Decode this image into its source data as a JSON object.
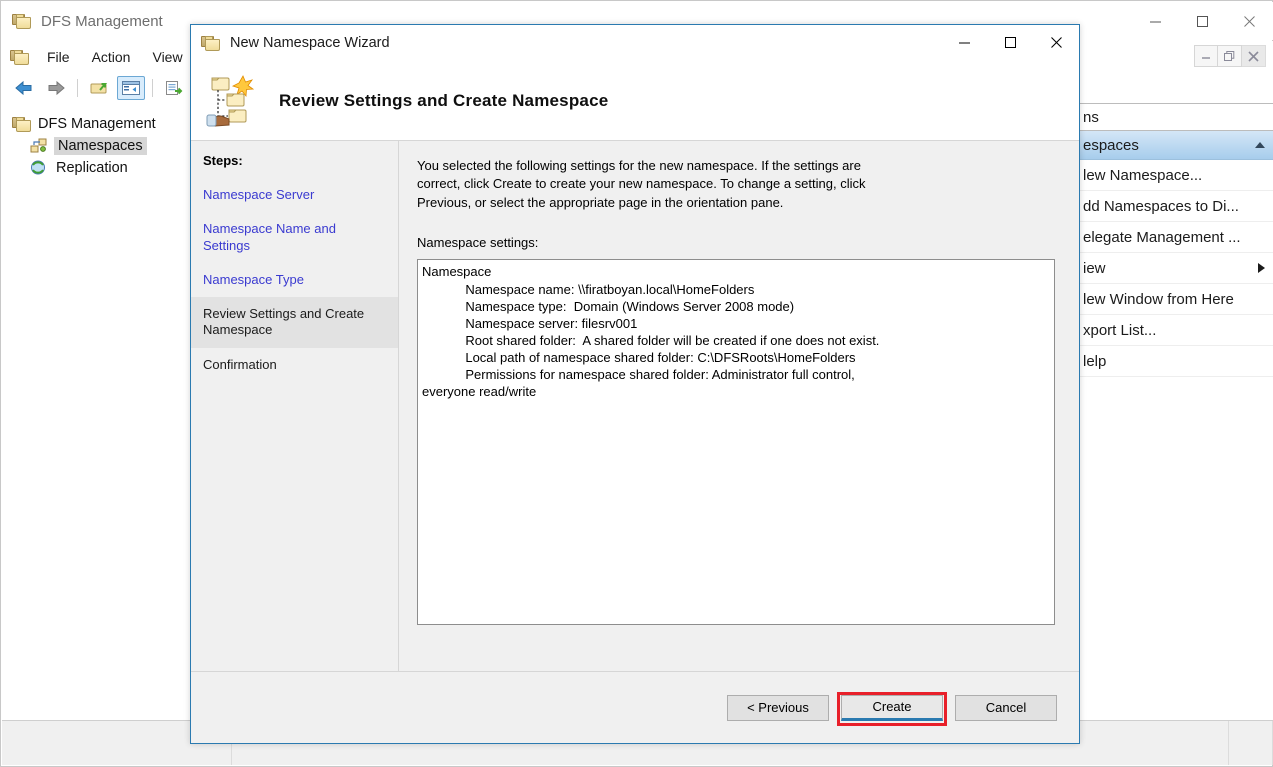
{
  "mmc": {
    "title": "DFS Management",
    "title_icon": "dfs-folder-icon",
    "menu": [
      {
        "label": "File"
      },
      {
        "label": "Action"
      },
      {
        "label": "View"
      }
    ],
    "toolbar": [
      {
        "name": "back-icon",
        "glyph": "←"
      },
      {
        "name": "forward-icon",
        "glyph": "→"
      },
      {
        "name": "up-folder-icon",
        "glyph": "↗"
      },
      {
        "name": "show-hide-console-tree-icon",
        "glyph": "▤"
      },
      {
        "name": "export-list-icon",
        "glyph": "≡"
      }
    ],
    "tree": [
      {
        "label": "DFS Management",
        "icon": "dfs-folder-icon",
        "selected": false,
        "level": 0
      },
      {
        "label": "Namespaces",
        "icon": "namespaces-icon",
        "selected": true,
        "level": 1
      },
      {
        "label": "Replication",
        "icon": "replication-icon",
        "selected": false,
        "level": 1
      }
    ],
    "window_controls": [
      {
        "name": "minimize-button",
        "glyph": "—"
      },
      {
        "name": "maximize-button",
        "glyph": "□"
      },
      {
        "name": "close-button",
        "glyph": "✕"
      }
    ],
    "mdi_controls": [
      {
        "name": "mdi-minimize-button",
        "glyph": "—"
      },
      {
        "name": "mdi-restore-button",
        "glyph": "❐"
      },
      {
        "name": "mdi-close-button",
        "glyph": "✕"
      }
    ]
  },
  "actions_pane": {
    "title": "ns",
    "group_header": "espaces",
    "items": [
      {
        "label": "lew Namespace...",
        "submenu": false
      },
      {
        "label": "dd Namespaces to Di...",
        "submenu": false
      },
      {
        "label": "elegate Management ...",
        "submenu": false
      },
      {
        "label": "iew",
        "submenu": true
      },
      {
        "label": "lew Window from Here",
        "submenu": false
      },
      {
        "label": "xport List...",
        "submenu": false
      },
      {
        "label": "lelp",
        "submenu": false
      }
    ]
  },
  "wizard": {
    "title": "New Namespace Wizard",
    "title_icon": "namespace-wizard-icon",
    "header_title": "Review Settings and Create Namespace",
    "header_icon": "namespace-create-icon",
    "window_controls": [
      {
        "name": "minimize-button",
        "glyph": "—"
      },
      {
        "name": "maximize-button",
        "glyph": "□"
      },
      {
        "name": "close-button",
        "glyph": "✕"
      }
    ],
    "steps_heading": "Steps:",
    "steps": [
      {
        "label": "Namespace Server",
        "state": "link"
      },
      {
        "label": "Namespace Name and Settings",
        "state": "link"
      },
      {
        "label": "Namespace Type",
        "state": "link"
      },
      {
        "label": "Review Settings and Create Namespace",
        "state": "current"
      },
      {
        "label": "Confirmation",
        "state": "future"
      }
    ],
    "intro_text": "You selected the following settings for the new namespace. If the settings are correct, click Create to create your new namespace. To change a setting, click Previous, or select the appropriate page in the orientation pane.",
    "settings_label": "Namespace settings:",
    "settings_text": "Namespace\n            Namespace name: \\\\firatboyan.local\\HomeFolders\n            Namespace type:  Domain (Windows Server 2008 mode)\n            Namespace server: filesrv001\n            Root shared folder:  A shared folder will be created if one does not exist.\n            Local path of namespace shared folder: C:\\DFSRoots\\HomeFolders\n            Permissions for namespace shared folder: Administrator full control,\neveryone read/write",
    "buttons": {
      "previous": "< Previous",
      "create": "Create",
      "cancel": "Cancel"
    },
    "highlight_color": "#e8202a",
    "default_button_accent": "#2a7ab0"
  }
}
